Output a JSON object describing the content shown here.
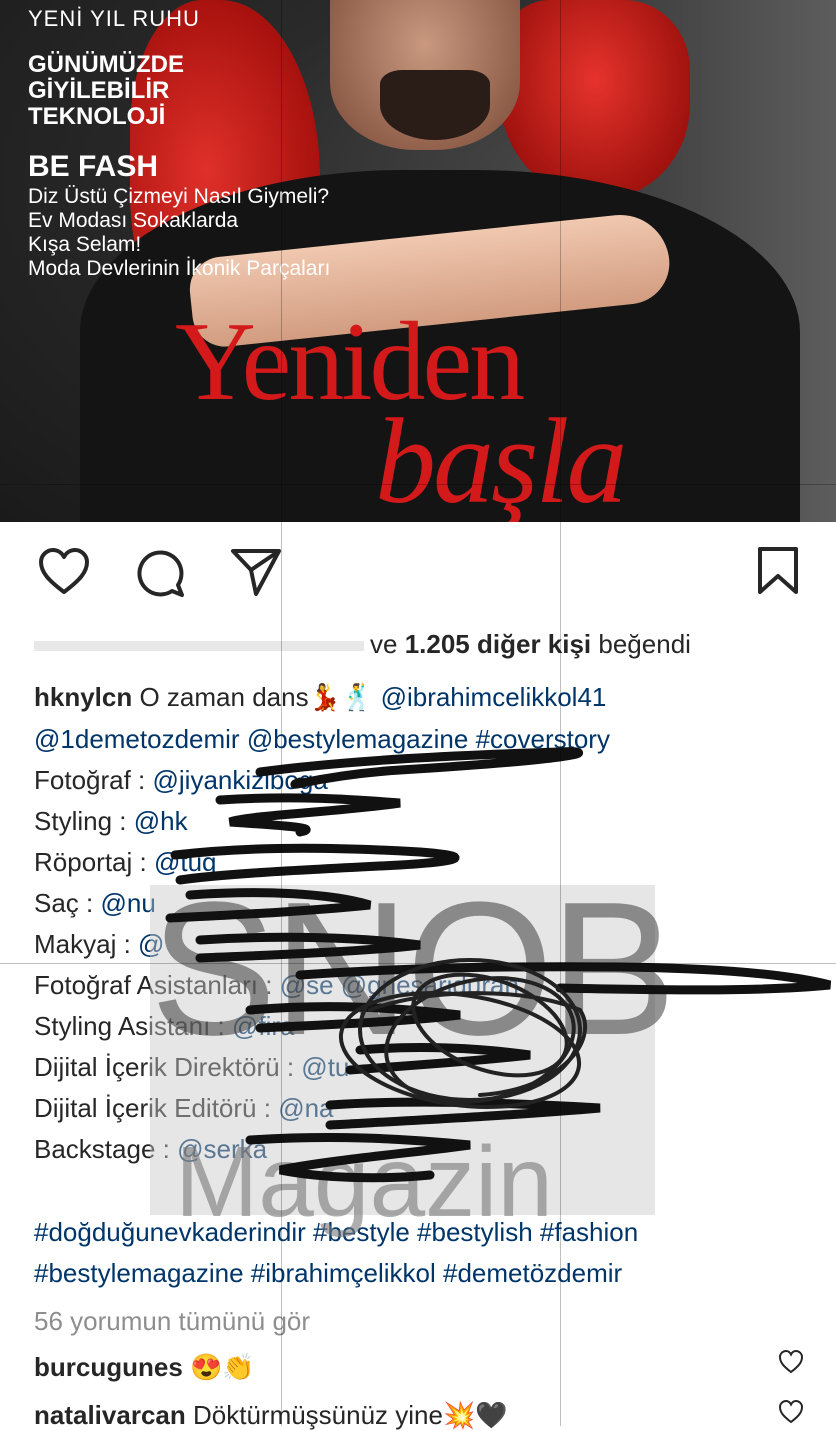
{
  "cover": {
    "kicker": "YENİ YIL RUHU",
    "headline_lines": [
      "GÜNÜMÜZDE",
      "GİYİLEBİLİR",
      "TEKNOLOJİ"
    ],
    "section": "BE FASH",
    "section_lines": [
      "Diz Üstü Çizmeyi Nasıl Giymeli?",
      "Ev Modası Sokaklarda",
      "Kışa Selam!",
      "Moda Devlerinin İkonik Parçaları"
    ],
    "title_word1": "Yeniden",
    "title_word2": "başla"
  },
  "actions": {
    "like": "heart-icon",
    "comment": "comment-icon",
    "share": "paper-plane-icon",
    "save": "bookmark-icon"
  },
  "likes": {
    "prefix": "ve",
    "count": "1.205 diğer kişi",
    "suffix": "beğendi"
  },
  "caption": {
    "username": "hknylcn",
    "text": "O zaman dans💃🕺",
    "mention1": "@ibrahimcelikkol41",
    "line2": [
      "@1demetozdemir",
      "@bestylemagazine",
      "#coverstory"
    ],
    "credits": [
      {
        "label": "Fotoğraf :",
        "handle": "@jiyankiziboga"
      },
      {
        "label": "Styling :",
        "handle": "@hk"
      },
      {
        "label": "Röportaj :",
        "handle": "@tug"
      },
      {
        "label": "Saç :",
        "handle": "@nu"
      },
      {
        "label": "Makyaj :",
        "handle": "@"
      },
      {
        "label": "Fotoğraf Asistanları :",
        "handle": "@se                  @gnesariduran"
      },
      {
        "label": "Styling Asistanı :",
        "handle": "@fira"
      },
      {
        "label": "Dijital İçerik Direktörü :",
        "handle": "@tu"
      },
      {
        "label": "Dijital İçerik Editörü :",
        "handle": "@na"
      },
      {
        "label": "Backstage :",
        "handle": "@serka"
      }
    ],
    "hashtags1": "#doğduğunevkaderindir #bestyle #bestylish  #fashion",
    "hashtags2": "#bestylemagazine #ibrahimçelikkol #demetözdemir"
  },
  "watermark": {
    "line1": "SNOB",
    "line2": "Magazin"
  },
  "view_all": "56 yorumun tümünü gör",
  "comments": [
    {
      "user": "burcugunes",
      "text": "😍👏"
    },
    {
      "user": "natalivarcan",
      "text": "Döktürmüşsünüz yine💥🖤"
    }
  ],
  "colors": {
    "link": "#003569",
    "muted": "#8e8e8e",
    "text": "#262626",
    "cover_red": "#d3191a"
  }
}
